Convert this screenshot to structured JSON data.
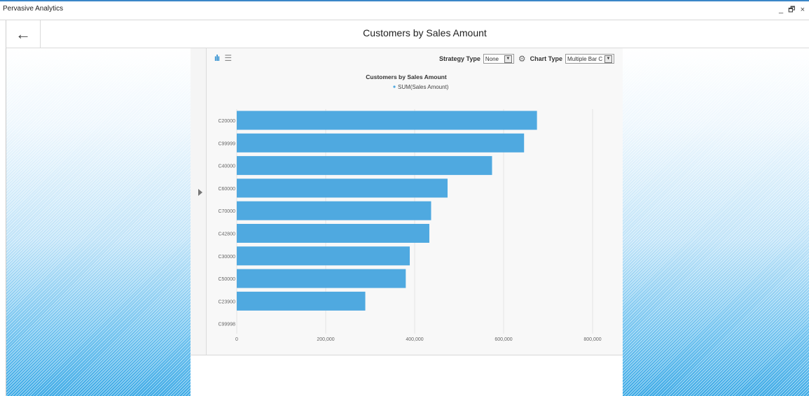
{
  "window": {
    "app_title": "Pervasive Analytics",
    "controls": [
      "_",
      "🗗",
      "×"
    ]
  },
  "header": {
    "back_icon": "←",
    "title": "Customers by Sales Amount"
  },
  "chart_toolbar": {
    "bar_view_icon": "ılı",
    "list_view_icon": "☰",
    "strategy_label": "Strategy Type",
    "strategy_value": "None",
    "chart_type_label": "Chart Type",
    "chart_type_value": "Multiple Bar Char"
  },
  "chart_data": {
    "type": "bar",
    "orientation": "horizontal",
    "title": "Customers by Sales Amount",
    "legend": [
      "SUM(Sales Amount)"
    ],
    "legend_placement": "top-center",
    "categories": [
      "C20000",
      "C99999",
      "C40000",
      "C60000",
      "C70000",
      "C42800",
      "C30000",
      "C50000",
      "C23900",
      "C99998"
    ],
    "series": [
      {
        "name": "SUM(Sales Amount)",
        "values": [
          675000,
          646000,
          574000,
          474000,
          437000,
          433000,
          389000,
          380000,
          289000,
          0
        ]
      }
    ],
    "x_ticks": [
      "0",
      "200,000",
      "400,000",
      "600,000",
      "800,000"
    ],
    "xlim": [
      0,
      800000
    ],
    "grid": "vertical",
    "bar_color": "#4fa9e0"
  }
}
